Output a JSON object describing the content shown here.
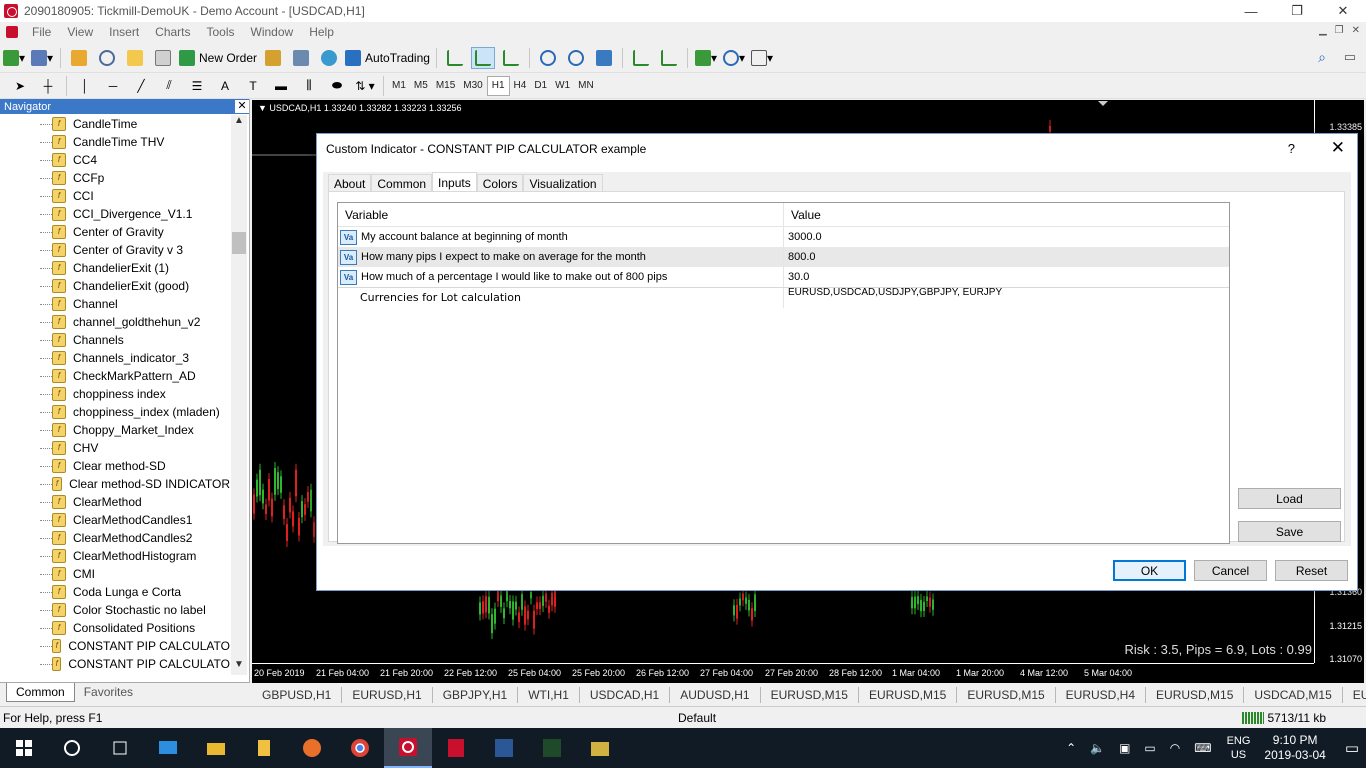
{
  "window": {
    "title": "2090180905: Tickmill-DemoUK - Demo Account - [USDCAD,H1]",
    "minimize": "—",
    "restore": "❐",
    "close": "✕"
  },
  "menu": [
    "File",
    "View",
    "Insert",
    "Charts",
    "Tools",
    "Window",
    "Help"
  ],
  "toolbar": {
    "new_order": "New Order",
    "auto_trading": "AutoTrading"
  },
  "timeframes": [
    "M1",
    "M5",
    "M15",
    "M30",
    "H1",
    "H4",
    "D1",
    "W1",
    "MN"
  ],
  "active_timeframe": "H1",
  "navigator": {
    "title": "Navigator",
    "close": "✕",
    "items": [
      "CandleTime",
      "CandleTime THV",
      "CC4",
      "CCFp",
      "CCI",
      "CCI_Divergence_V1.1",
      "Center of Gravity",
      "Center of Gravity v 3",
      "ChandelierExit (1)",
      "ChandelierExit (good)",
      "Channel",
      "channel_goldthehun_v2",
      "Channels",
      "Channels_indicator_3",
      "CheckMarkPattern_AD",
      "choppiness index",
      "choppiness_index (mladen)",
      "Choppy_Market_Index",
      "CHV",
      "Clear method-SD",
      "Clear method-SD INDICATOR",
      "ClearMethod",
      "ClearMethodCandles1",
      "ClearMethodCandles2",
      "ClearMethodHistogram",
      "CMI",
      "Coda Lunga e Corta",
      "Color Stochastic no label",
      "Consolidated Positions",
      "CONSTANT PIP CALCULATO",
      "CONSTANT PIP CALCULATO"
    ],
    "tabs": [
      "Common",
      "Favorites"
    ]
  },
  "chart": {
    "info": "USDCAD,H1  1.33240 1.33282 1.33223 1.33256",
    "prices": [
      "1.33385",
      "1.31360",
      "1.31215",
      "1.31070"
    ],
    "times": [
      "20 Feb 2019",
      "21 Feb 04:00",
      "21 Feb 20:00",
      "22 Feb 12:00",
      "25 Feb 04:00",
      "25 Feb 20:00",
      "26 Feb 12:00",
      "27 Feb 04:00",
      "27 Feb 20:00",
      "28 Feb 12:00",
      "1 Mar 04:00",
      "1 Mar 20:00",
      "4 Mar 12:00",
      "5 Mar 04:00"
    ],
    "risk_text": "Risk : 3.5, Pips = 6.9, Lots : 0.99"
  },
  "chart_tabs": [
    "GBPUSD,H1",
    "EURUSD,H1",
    "GBPJPY,H1",
    "WTI,H1",
    "USDCAD,H1",
    "AUDUSD,H1",
    "EURUSD,M15",
    "EURUSD,M15",
    "EURUSD,M15",
    "EURUSD,H4",
    "EURUSD,M15",
    "USDCAD,M15",
    "EURU"
  ],
  "status": {
    "help": "For Help, press F1",
    "profile": "Default",
    "traffic": "5713/11 kb"
  },
  "taskbar": {
    "lang1": "ENG",
    "lang2": "US",
    "time": "9:10 PM",
    "date": "2019-03-04"
  },
  "dialog": {
    "title": "Custom Indicator - CONSTANT PIP CALCULATOR example",
    "help": "?",
    "close": "✕",
    "tabs": [
      "About",
      "Common",
      "Inputs",
      "Colors",
      "Visualization"
    ],
    "active_tab": "Inputs",
    "columns": {
      "variable": "Variable",
      "value": "Value"
    },
    "rows": [
      {
        "icon": "Va",
        "variable": "My account balance at beginning of month",
        "value": "3000.0"
      },
      {
        "icon": "Va",
        "variable": "How many pips I expect to make on average for the month",
        "value": "800.0"
      },
      {
        "icon": "Va",
        "variable": "How much of a percentage I would like to make out of 800 pips",
        "value": "30.0"
      }
    ],
    "text_row": {
      "variable": "Currencies for Lot calculation",
      "value": "EURUSD,USDCAD,USDJPY,GBPJPY, EURJPY"
    },
    "buttons": {
      "load": "Load",
      "save": "Save",
      "ok": "OK",
      "cancel": "Cancel",
      "reset": "Reset"
    }
  }
}
